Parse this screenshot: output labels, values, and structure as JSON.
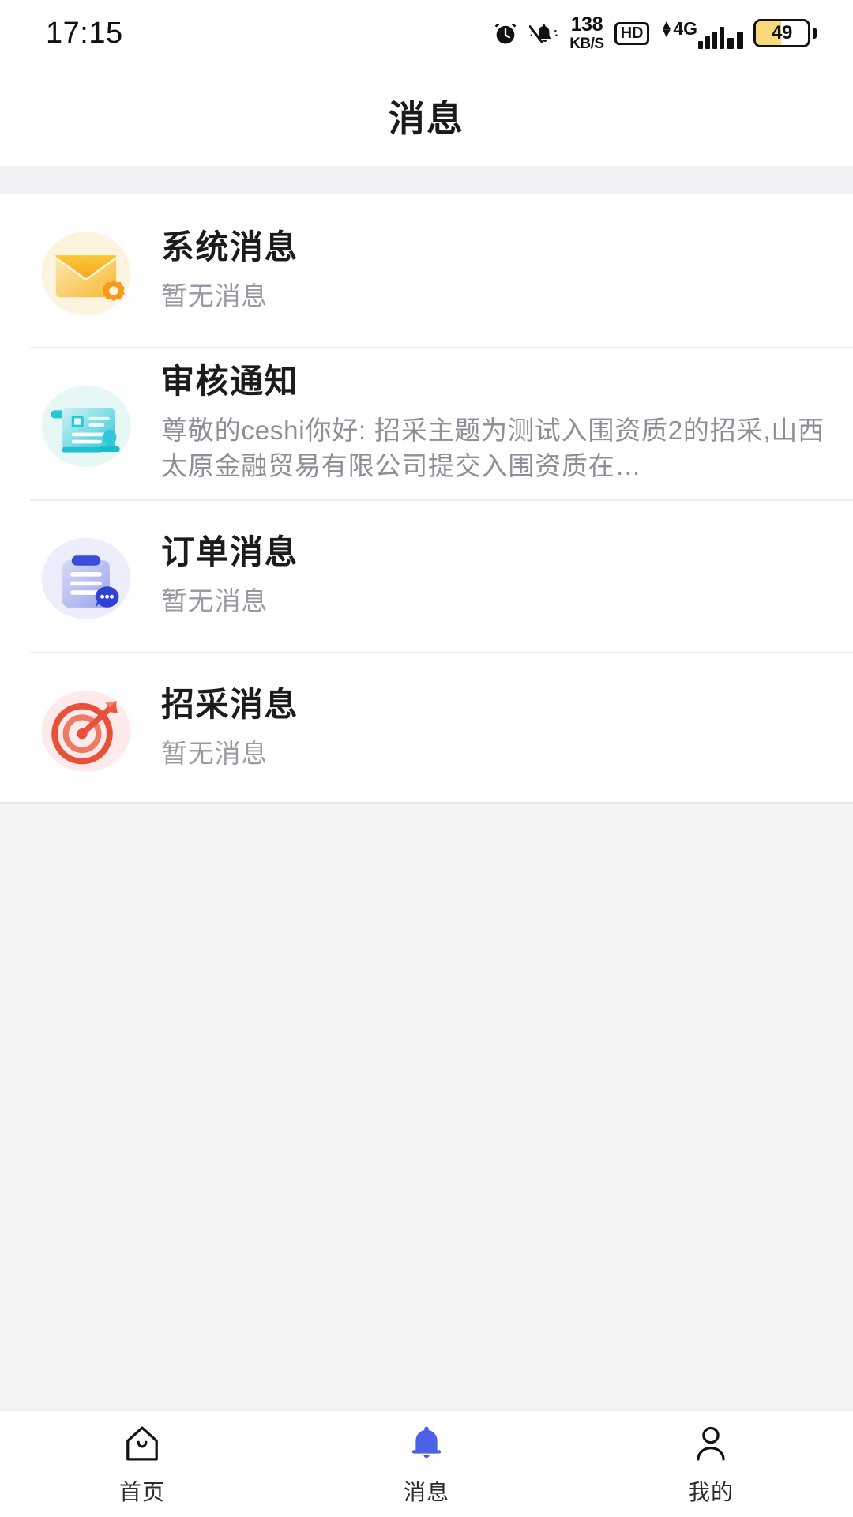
{
  "status_bar": {
    "time": "17:15",
    "net_speed_value": "138",
    "net_speed_unit": "KB/S",
    "hd_label": "HD",
    "network_type": "4G",
    "battery_percent": "49",
    "icons": [
      "alarm-clock-icon",
      "bell-muted-icon",
      "hd-badge-icon",
      "signal-bars-icon",
      "battery-icon"
    ]
  },
  "header": {
    "title": "消息"
  },
  "messages": {
    "items": [
      {
        "icon": "envelope-gear-icon",
        "title": "系统消息",
        "subtitle": "暂无消息",
        "icon_bg": "#FDF6E3",
        "icon_color": "#F5B731"
      },
      {
        "icon": "document-stamp-icon",
        "title": "审核通知",
        "subtitle": "尊敬的ceshi你好: 招采主题为测试入围资质2的招采,山西太原金融贸易有限公司提交入围资质在…",
        "icon_bg": "#E4F7F6",
        "icon_color": "#27C6D9"
      },
      {
        "icon": "clipboard-chat-icon",
        "title": "订单消息",
        "subtitle": "暂无消息",
        "icon_bg": "#EDEEFB",
        "icon_color": "#3B4BDB"
      },
      {
        "icon": "target-arrow-icon",
        "title": "招采消息",
        "subtitle": "暂无消息",
        "icon_bg": "#FDEAEA",
        "icon_color": "#E8503A"
      }
    ]
  },
  "tabbar": {
    "active_color": "#4B62E8",
    "inactive_color": "#1A1A1A",
    "items": [
      {
        "icon": "home-icon",
        "label": "首页",
        "active": "false"
      },
      {
        "icon": "bell-icon",
        "label": "消息",
        "active": "true"
      },
      {
        "icon": "person-icon",
        "label": "我的",
        "active": "false"
      }
    ]
  }
}
